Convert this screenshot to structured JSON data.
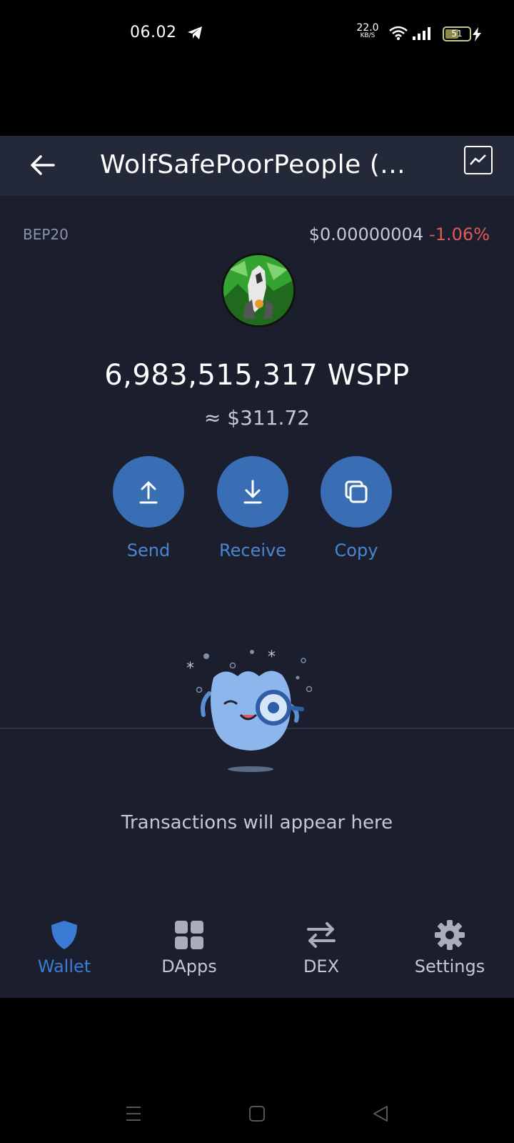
{
  "status_bar": {
    "time": "06.02",
    "network_speed_value": "22.0",
    "network_speed_unit": "KB/S",
    "battery_level": "51",
    "icons": [
      "telegram-icon",
      "wifi-icon",
      "signal-icon",
      "battery-icon",
      "charging-icon"
    ]
  },
  "header": {
    "title": "WolfSafePoorPeople (...",
    "back_icon": "arrow-left-icon",
    "chart_icon": "chart-line-icon"
  },
  "token": {
    "network": "BEP20",
    "price": "$0.00000004",
    "change": "-1.06%",
    "balance": "6,983,515,317 WSPP",
    "fiat_value": "≈ $311.72"
  },
  "actions": [
    {
      "label": "Send",
      "icon": "arrow-up-icon"
    },
    {
      "label": "Receive",
      "icon": "arrow-down-icon"
    },
    {
      "label": "Copy",
      "icon": "copy-icon"
    }
  ],
  "empty_state": {
    "text": "Transactions will appear here"
  },
  "tabs": [
    {
      "label": "Wallet",
      "icon": "shield-icon",
      "active": true
    },
    {
      "label": "DApps",
      "icon": "grid-icon",
      "active": false
    },
    {
      "label": "DEX",
      "icon": "swap-icon",
      "active": false
    },
    {
      "label": "Settings",
      "icon": "gear-icon",
      "active": false
    }
  ],
  "colors": {
    "background": "#1b1f2d",
    "header": "#232938",
    "accent": "#3a6eb4",
    "accent_text": "#4a86d0",
    "negative": "#e05a5a"
  }
}
